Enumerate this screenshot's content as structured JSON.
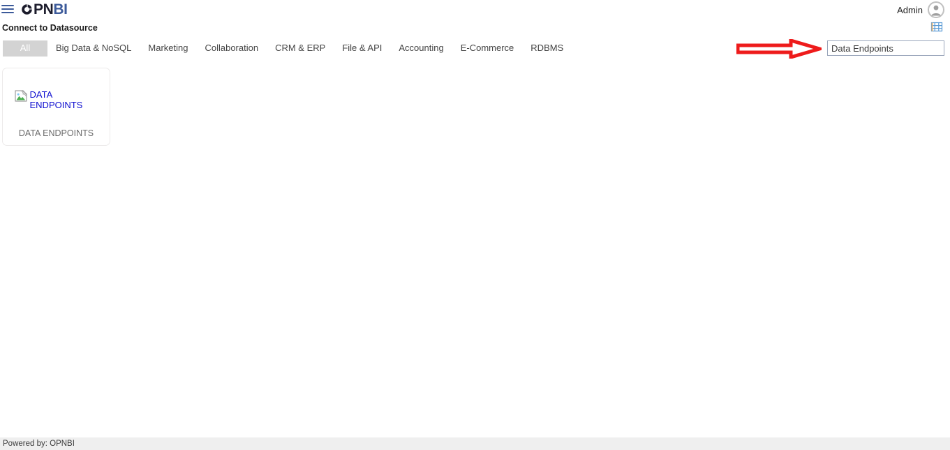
{
  "brand": {
    "hamburger_icon": "hamburger-menu-icon",
    "logo_mark_icon": "opnbi-circle-mark-icon",
    "logo_dark_text": "PN",
    "logo_blue_text": "BI",
    "accent_blue": "#3c5a9a",
    "dark_navy": "#1b1b2b"
  },
  "header": {
    "user_name": "Admin",
    "avatar_icon": "user-avatar-icon",
    "grid_icon": "table-grid-icon"
  },
  "page": {
    "title": "Connect to Datasource"
  },
  "tabs": [
    {
      "label": "All",
      "active": true
    },
    {
      "label": "Big Data & NoSQL",
      "active": false
    },
    {
      "label": "Marketing",
      "active": false
    },
    {
      "label": "Collaboration",
      "active": false
    },
    {
      "label": "CRM & ERP",
      "active": false
    },
    {
      "label": "File & API",
      "active": false
    },
    {
      "label": "Accounting",
      "active": false
    },
    {
      "label": "E-Commerce",
      "active": false
    },
    {
      "label": "RDBMS",
      "active": false
    }
  ],
  "search": {
    "value": "Data Endpoints",
    "placeholder": "Search"
  },
  "annotation": {
    "arrow_icon": "red-block-arrow-icon",
    "arrow_color": "#ee1b1b",
    "arrow_fill": "#ffffff"
  },
  "cards": [
    {
      "image_icon": "broken-image-icon",
      "image_alt": "DATA ENDPOINTS",
      "label": "DATA ENDPOINTS"
    }
  ],
  "footer": {
    "text": "Powered by: OPNBI"
  }
}
